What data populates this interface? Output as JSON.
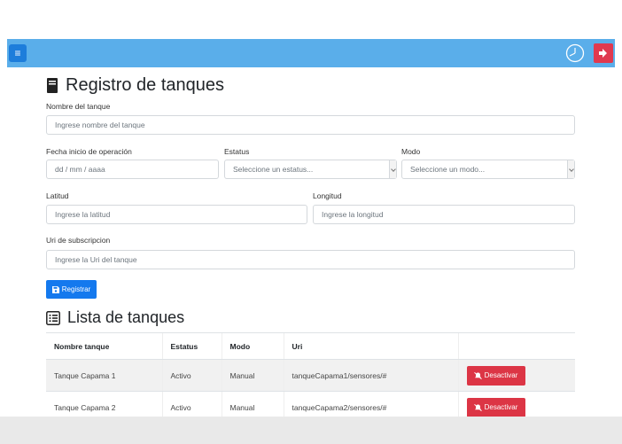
{
  "header": {
    "menu_icon": "hamburger-icon",
    "clock_icon": "clock-icon",
    "logout_icon": "sign-out-icon",
    "bar_color": "#5aaeea",
    "logout_color": "#e0394f"
  },
  "form": {
    "title": "Registro de tanques",
    "title_icon": "book-icon",
    "nombre": {
      "label": "Nombre del tanque",
      "placeholder": "Ingrese nombre del tanque"
    },
    "fecha": {
      "label": "Fecha inicio de operación",
      "placeholder": "dd / mm / aaaa"
    },
    "estatus": {
      "label": "Estatus",
      "selected": "Seleccione un estatus..."
    },
    "modo": {
      "label": "Modo",
      "selected": "Seleccione un modo..."
    },
    "latitud": {
      "label": "Latitud",
      "placeholder": "Ingrese la latitud"
    },
    "longitud": {
      "label": "Longitud",
      "placeholder": "Ingrese la longitud"
    },
    "uri": {
      "label": "Uri de subscripcion",
      "placeholder": "Ingrese la Uri del tanque"
    },
    "submit_label": "Registrar",
    "submit_icon": "save-icon",
    "primary_color": "#1479ee"
  },
  "list": {
    "title": "Lista de tanques",
    "title_icon": "list-icon",
    "columns": [
      "Nombre tanque",
      "Estatus",
      "Modo",
      "Uri",
      ""
    ],
    "rows": [
      {
        "nombre": "Tanque Capama 1",
        "estatus": "Activo",
        "modo": "Manual",
        "uri": "tanqueCapama1/sensores/#",
        "action": "Desactivar"
      },
      {
        "nombre": "Tanque Capama 2",
        "estatus": "Activo",
        "modo": "Manual",
        "uri": "tanqueCapama2/sensores/#",
        "action": "Desactivar"
      }
    ],
    "danger_color": "#dc3545",
    "action_icon": "bell-slash-icon"
  }
}
